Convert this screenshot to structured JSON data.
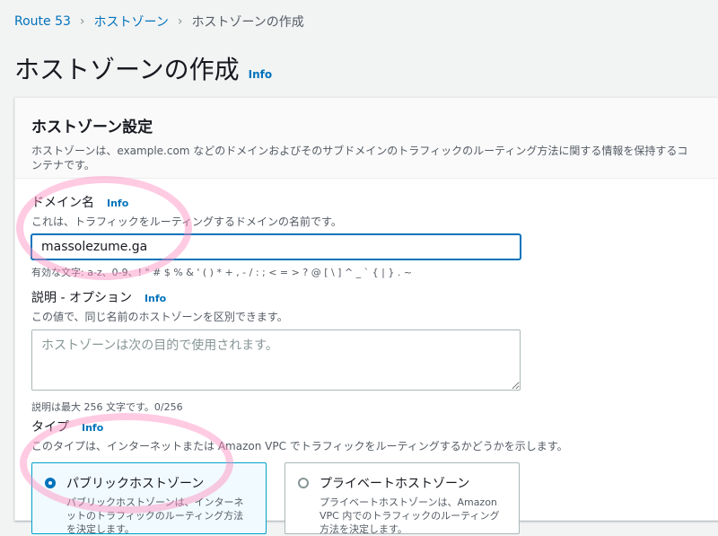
{
  "breadcrumb": {
    "items": [
      "Route 53",
      "ホストゾーン"
    ],
    "current": "ホストゾーンの作成"
  },
  "page": {
    "title": "ホストゾーンの作成",
    "info": "Info"
  },
  "panel": {
    "title": "ホストゾーン設定",
    "description": "ホストゾーンは、example.com などのドメインおよびそのサブドメインのトラフィックのルーティング方法に関する情報を保持するコンテナです。"
  },
  "domain": {
    "label": "ドメイン名",
    "info": "Info",
    "description": "これは、トラフィックをルーティングするドメインの名前です。",
    "value": "massolezume.ga",
    "constraint": "有効な文字: a-z、0-9、! \" # $ % & ' ( ) * + , - / : ; < = > ? @ [ \\ ] ^ _ ` { | } . ~"
  },
  "comment": {
    "label": "説明 - オプション",
    "info": "Info",
    "description": "この値で、同じ名前のホストゾーンを区別できます。",
    "placeholder": "ホストゾーンは次の目的で使用されます。",
    "counter": "説明は最大 256 文字です。0/256"
  },
  "type": {
    "label": "タイプ",
    "info": "Info",
    "description": "このタイプは、インターネットまたは Amazon VPC でトラフィックをルーティングするかどうかを示します。",
    "options": [
      {
        "title": "パブリックホストゾーン",
        "description": "パブリックホストゾーンは、インターネットのトラフィックのルーティング方法を決定します。",
        "checked": true
      },
      {
        "title": "プライベートホストゾーン",
        "description": "プライベートホストゾーンは、Amazon VPC 内でのトラフィックのルーティング方法を決定します。",
        "checked": false
      }
    ]
  },
  "colors": {
    "link": "#0073bb",
    "highlight": "#ff8cbe"
  }
}
